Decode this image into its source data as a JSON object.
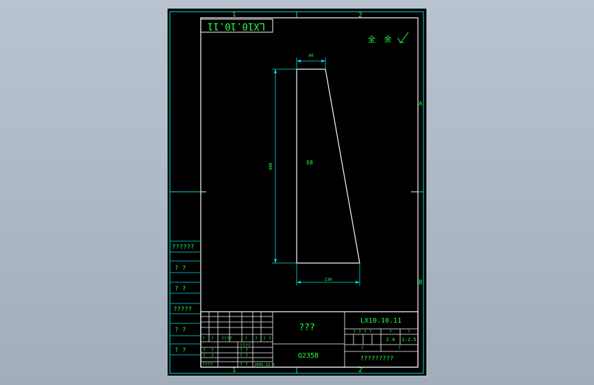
{
  "colors": {
    "background_outer": "#aab4c2",
    "sheet": "#000000",
    "border_line": "#00e5e5",
    "text": "#22ff44",
    "part_line": "#ffffff"
  },
  "drawing": {
    "top_number_box": "LX10.10.11",
    "roughness_note": "全  余",
    "zone_top_1": "1",
    "zone_top_2": "2",
    "zone_bottom_1": "1",
    "zone_bottom_2": "2",
    "zone_right_a": "A",
    "zone_right_b": "B",
    "dim_top_width": "60",
    "dim_height": "400",
    "dim_bottom_width": "130",
    "thickness_note": "δ8"
  },
  "left_strip": {
    "cells": [
      "??????",
      "?   ?",
      "?   ?",
      "?????",
      "?   ?",
      "?   ?"
    ]
  },
  "title_block": {
    "part_name": "???",
    "material": "Q235B",
    "drawing_number": "LX10.10.11",
    "company": "?????????",
    "stage_header": "?  ?  ?  ?",
    "weight_header": "?",
    "scale_header": "?",
    "weight_value": "2.4",
    "scale_value": "1:2.5",
    "sheet_left": "?",
    "sheet_right": "?",
    "rev_labels": [
      "?",
      "?",
      "????",
      "?",
      "?",
      "?",
      "?"
    ],
    "sign_rows": [
      [
        "?",
        "?",
        "",
        "?",
        "?"
      ],
      [
        "?",
        "?",
        "",
        "?",
        "?"
      ],
      [
        "????",
        "",
        "",
        "?",
        "?"
      ]
    ],
    "date_value": "2005.12.8",
    "designer_label": "????"
  }
}
